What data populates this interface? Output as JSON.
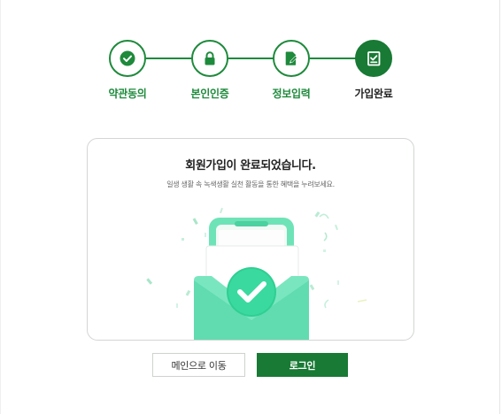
{
  "steps": [
    {
      "label": "약관동의",
      "icon": "check-icon",
      "state": "done"
    },
    {
      "label": "본인인증",
      "icon": "lock-icon",
      "state": "done"
    },
    {
      "label": "정보입력",
      "icon": "edit-document-icon",
      "state": "done"
    },
    {
      "label": "가입완료",
      "icon": "signup-complete-icon",
      "state": "active"
    }
  ],
  "card": {
    "title": "회원가입이 완료되었습니다.",
    "subtitle": "일생 생활 속 녹색생활 실천 활동을 통한 혜택을 누려보세요."
  },
  "buttons": {
    "main_label": "메인으로 이동",
    "login_label": "로그인"
  },
  "colors": {
    "brand_green": "#1e8a3c",
    "brand_green_dark": "#187a34",
    "illustration_mint": "#5fdcae"
  }
}
